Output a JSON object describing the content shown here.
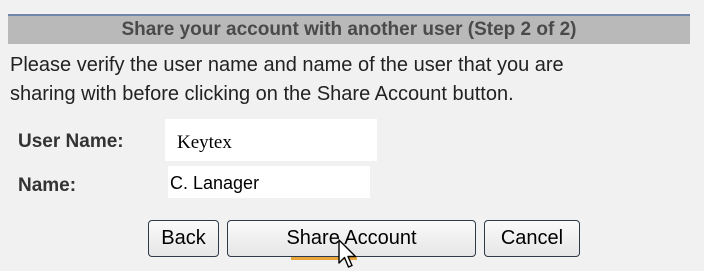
{
  "header": {
    "title": "Share your account with another user (Step 2 of 2)"
  },
  "instructions": {
    "line1": "Please verify the user name and name of the user that you are",
    "line2": "sharing with before clicking on the Share Account button."
  },
  "fields": {
    "user_name_label": "User Name:",
    "user_name_value": "Keytex",
    "name_label": "Name:",
    "name_value": "C. Lanager"
  },
  "buttons": {
    "back": "Back",
    "share": "Share Account",
    "cancel": "Cancel"
  },
  "colors": {
    "header_bg": "#b9b9b9",
    "header_border": "#6f86a8",
    "hover_underline": "#e9a43a"
  },
  "icons": {
    "cursor": "mouse-pointer-arrow"
  }
}
